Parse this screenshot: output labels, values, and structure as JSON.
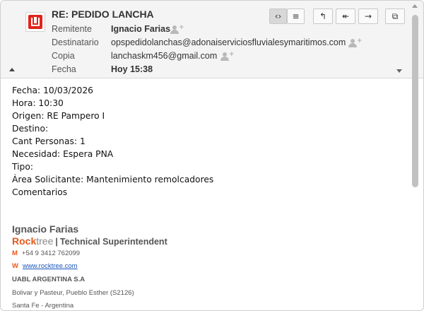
{
  "header": {
    "subject": "RE: PEDIDO LANCHA",
    "fields": [
      {
        "label": "Remitente",
        "value": "Ignacio Farias"
      },
      {
        "label": "Destinatario",
        "value": "opspedidolanchas@adonaiserviciosfluvialesymaritimos.com"
      },
      {
        "label": "Copia",
        "value": "lanchaskm456@gmail.com"
      },
      {
        "label": "Fecha",
        "value": "Hoy 15:38"
      }
    ],
    "toolbar": [
      {
        "name": "toggle-source-button",
        "glyph": "‹›",
        "icon": "code-icon"
      },
      {
        "name": "headers-button",
        "glyph": "≡",
        "icon": "menu-icon"
      },
      {
        "name": "reply-button",
        "glyph": "↰",
        "icon": "reply-icon"
      },
      {
        "name": "reply-all-button",
        "glyph": "↞",
        "icon": "reply-all-icon"
      },
      {
        "name": "forward-button",
        "glyph": "→",
        "icon": "forward-icon"
      },
      {
        "name": "open-window-button",
        "glyph": "⧉",
        "icon": "new-window-icon"
      }
    ]
  },
  "body": {
    "lines": [
      "Fecha: 10/03/2026",
      "Hora: 10:30",
      "Origen: RE Pampero I",
      "Destino:",
      "Cant Personas: 1",
      "Necesidad: Espera PNA",
      "Tipo:",
      "Área Solicitante: Mantenimiento remolcadores",
      "Comentarios"
    ]
  },
  "signature": {
    "name": "Ignacio Farias",
    "brand_rock": "Rock",
    "brand_tree": "tree",
    "separator": "|",
    "role": "Technical Superintendent",
    "phone_key": "M",
    "phone": "+54 9 3412 762099",
    "web_key": "W",
    "web": "www.rocktree.com",
    "company": "UABL ARGENTINA S.A",
    "address1": "Bolivar y Pasteur, Pueblo Esther (S2126)",
    "address2": "Santa Fe - Argentina"
  },
  "colors": {
    "brand_orange": "#e8581c",
    "avatar_red": "#e2231a",
    "link_blue": "#1a55b8"
  }
}
